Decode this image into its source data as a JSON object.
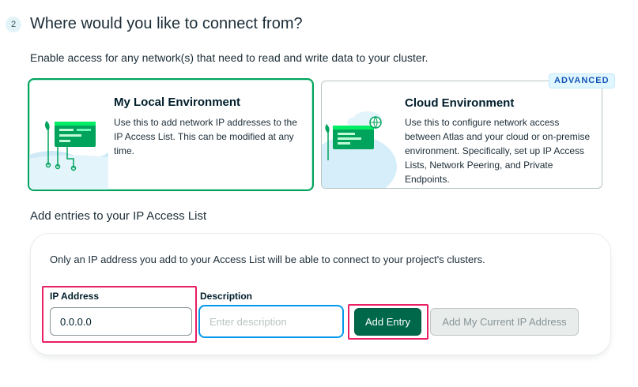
{
  "step": {
    "number": "2",
    "heading": "Where would you like to connect from?",
    "intro": "Enable access for any network(s) that need to read and write data to your cluster."
  },
  "options": {
    "local": {
      "title": "My Local Environment",
      "description": "Use this to add network IP addresses to the IP Access List. This can be modified at any time.",
      "selected": true,
      "illustration": "local-network-illustration"
    },
    "cloud": {
      "title": "Cloud Environment",
      "description": "Use this to configure network access between Atlas and your cloud or on-premise environment. Specifically, set up IP Access Lists, Network Peering, and Private Endpoints.",
      "badge": "ADVANCED",
      "illustration": "cloud-network-illustration"
    }
  },
  "access_list": {
    "heading": "Add entries to your IP Access List",
    "note": "Only an IP address you add to your Access List will be able to connect to your project's clusters.",
    "ip_label": "IP Address",
    "ip_value": "0.0.0.0",
    "description_label": "Description",
    "description_placeholder": "Enter description",
    "add_button": "Add Entry",
    "current_ip_button": "Add My Current IP Address"
  },
  "colors": {
    "selected_border": "#00a35c",
    "primary_button": "#00684a",
    "focus_border": "#0498ec",
    "highlight": "#e91e63",
    "badge_text": "#1254b7"
  }
}
